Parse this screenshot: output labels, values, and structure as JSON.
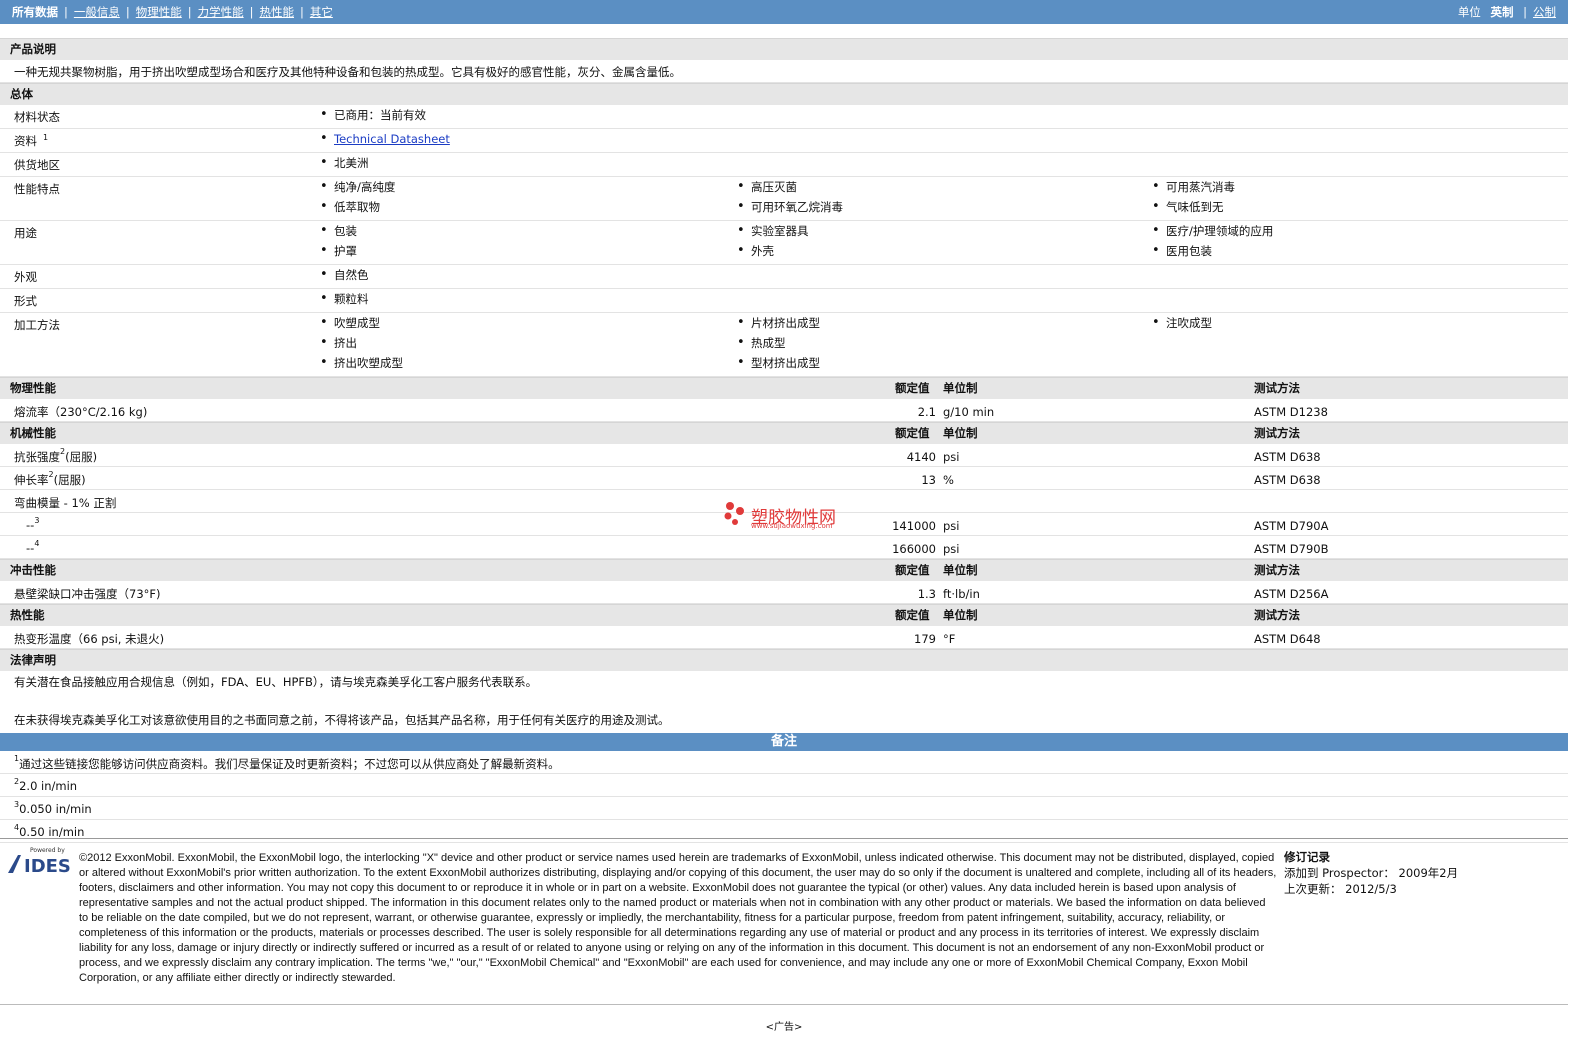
{
  "nav": {
    "items": [
      "所有数据",
      "一般信息",
      "物理性能",
      "力学性能",
      "热性能",
      "其它"
    ],
    "units_label": "单位",
    "unit_english": "英制",
    "unit_metric": "公制"
  },
  "product_desc": {
    "heading": "产品说明",
    "text": "一种无规共聚物树脂，用于挤出吹塑成型场合和医疗及其他特种设备和包装的热成型。它具有极好的感官性能，灰分、金属含量低。"
  },
  "general": {
    "heading": "总体",
    "rows": [
      {
        "label": "材料状态",
        "sup": "",
        "cols": [
          [
            "已商用：当前有效"
          ]
        ]
      },
      {
        "label": "资料",
        "sup": "1",
        "link": "Technical Datasheet"
      },
      {
        "label": "供货地区",
        "sup": "",
        "cols": [
          [
            "北美洲"
          ]
        ]
      },
      {
        "label": "性能特点",
        "sup": "",
        "cols": [
          [
            "纯净/高纯度",
            "低萃取物"
          ],
          [
            "高压灭菌",
            "可用环氧乙烷消毒"
          ],
          [
            "可用蒸汽消毒",
            "气味低到无"
          ]
        ]
      },
      {
        "label": "用途",
        "sup": "",
        "cols": [
          [
            "包装",
            "护罩"
          ],
          [
            "实验室器具",
            "外壳"
          ],
          [
            "医疗/护理领域的应用",
            "医用包装"
          ]
        ]
      },
      {
        "label": "外观",
        "sup": "",
        "cols": [
          [
            "自然色"
          ]
        ]
      },
      {
        "label": "形式",
        "sup": "",
        "cols": [
          [
            "颗粒料"
          ]
        ]
      },
      {
        "label": "加工方法",
        "sup": "",
        "cols": [
          [
            "吹塑成型",
            "挤出",
            "挤出吹塑成型"
          ],
          [
            "片材挤出成型",
            "热成型",
            "型材挤出成型"
          ],
          [
            "注吹成型"
          ]
        ]
      }
    ]
  },
  "col_headers": {
    "nominal": "额定值",
    "unit": "单位制",
    "method": "测试方法"
  },
  "physical": {
    "heading": "物理性能",
    "rows": [
      {
        "label": "熔流率（230°C/2.16 kg)",
        "value": "2.1",
        "unit": "g/10 min",
        "method": "ASTM D1238"
      }
    ]
  },
  "mechanical": {
    "heading": "机械性能",
    "rows": [
      {
        "label": "抗张强度",
        "sup": "2",
        "suffix": "(屈服)",
        "value": "4140",
        "unit": "psi",
        "method": "ASTM D638"
      },
      {
        "label": "伸长率",
        "sup": "2",
        "suffix": "(屈服)",
        "value": "13",
        "unit": "%",
        "method": "ASTM D638"
      },
      {
        "label": "弯曲模量 - 1% 正割",
        "sup": "",
        "suffix": "",
        "value": "",
        "unit": "",
        "method": ""
      },
      {
        "label": "--",
        "sup": "3",
        "suffix": "",
        "value": "141000",
        "unit": "psi",
        "method": "ASTM D790A"
      },
      {
        "label": "--",
        "sup": "4",
        "suffix": "",
        "value": "166000",
        "unit": "psi",
        "method": "ASTM D790B"
      }
    ]
  },
  "impact": {
    "heading": "冲击性能",
    "rows": [
      {
        "label": "悬壁梁缺口冲击强度（73°F)",
        "value": "1.3",
        "unit": "ft·lb/in",
        "method": "ASTM D256A"
      }
    ]
  },
  "thermal": {
    "heading": "热性能",
    "rows": [
      {
        "label": "热变形温度（66 psi, 未退火)",
        "value": "179",
        "unit": "°F",
        "method": "ASTM D648"
      }
    ]
  },
  "legal": {
    "heading": "法律声明",
    "p1": "有关潜在食品接触应用合规信息（例如，FDA、EU、HPFB），请与埃克森美孚化工客户服务代表联系。",
    "p2": "在未获得埃克森美孚化工对该意欲使用目的之书面同意之前，不得将该产品，包括其产品名称，用于任何有关医疗的用途及测试。"
  },
  "notes": {
    "heading": "备注",
    "items": [
      {
        "sup": "1",
        "text": "通过这些链接您能够访问供应商资料。我们尽量保证及时更新资料；不过您可以从供应商处了解最新资料。"
      },
      {
        "sup": "2",
        "text": "2.0 in/min"
      },
      {
        "sup": "3",
        "text": "0.050 in/min"
      },
      {
        "sup": "4",
        "text": "0.50 in/min"
      }
    ]
  },
  "watermark": {
    "title": "塑胶物性网",
    "url": "www.sujiaowuxing.com"
  },
  "footer": {
    "logo_small": "Powered by",
    "logo_text": "IDES",
    "copyright": "©2012 ExxonMobil. ExxonMobil, the ExxonMobil logo, the interlocking \"X\" device and other product or service names used herein are trademarks of ExxonMobil, unless indicated otherwise. This document may not be distributed, displayed, copied or altered without ExxonMobil's prior written authorization. To the extent ExxonMobil authorizes distributing, displaying and/or copying of this document, the user may do so only if the document is unaltered and complete, including all of its headers, footers, disclaimers and other information. You may not copy this document to or reproduce it in whole or in part on a website. ExxonMobil does not guarantee the typical (or other) values. Any data included herein is based upon analysis of representative samples and not the actual product shipped. The information in this document relates only to the named product or materials when not in combination with any other product or materials. We based the information on data believed to be reliable on the date compiled, but we do not represent, warrant, or otherwise guarantee, expressly or impliedly, the merchantability, fitness for a particular purpose, freedom from patent infringement, suitability, accuracy, reliability, or completeness of this information or the products, materials or processes described. The user is solely responsible for all determinations regarding any use of material or product and any process in its territories of interest. We expressly disclaim liability for any loss, damage or injury directly or indirectly suffered or incurred as a result of or related to anyone using or relying on any of the information in this document. This document is not an endorsement of any non-ExxonMobil product or process, and we expressly disclaim any contrary implication. The terms \"we,\" \"our,\" \"ExxonMobil Chemical\" and \"ExxonMobil\" are each used for convenience, and may include any one or more of ExxonMobil Chemical Company, Exxon Mobil Corporation, or any affiliate either directly or indirectly stewarded.",
    "rev_heading": "修订记录",
    "added_label": "添加到 Prospector：",
    "added_value": "2009年2月",
    "updated_label": "上次更新：",
    "updated_value": "2012/5/3"
  },
  "ad": "<广告>",
  "colors": {
    "nav_blue": "#5b8fc3",
    "section_gray": "#e6e6e6",
    "link_blue": "#1b3cc4",
    "watermark_red": "#e03a3a"
  }
}
